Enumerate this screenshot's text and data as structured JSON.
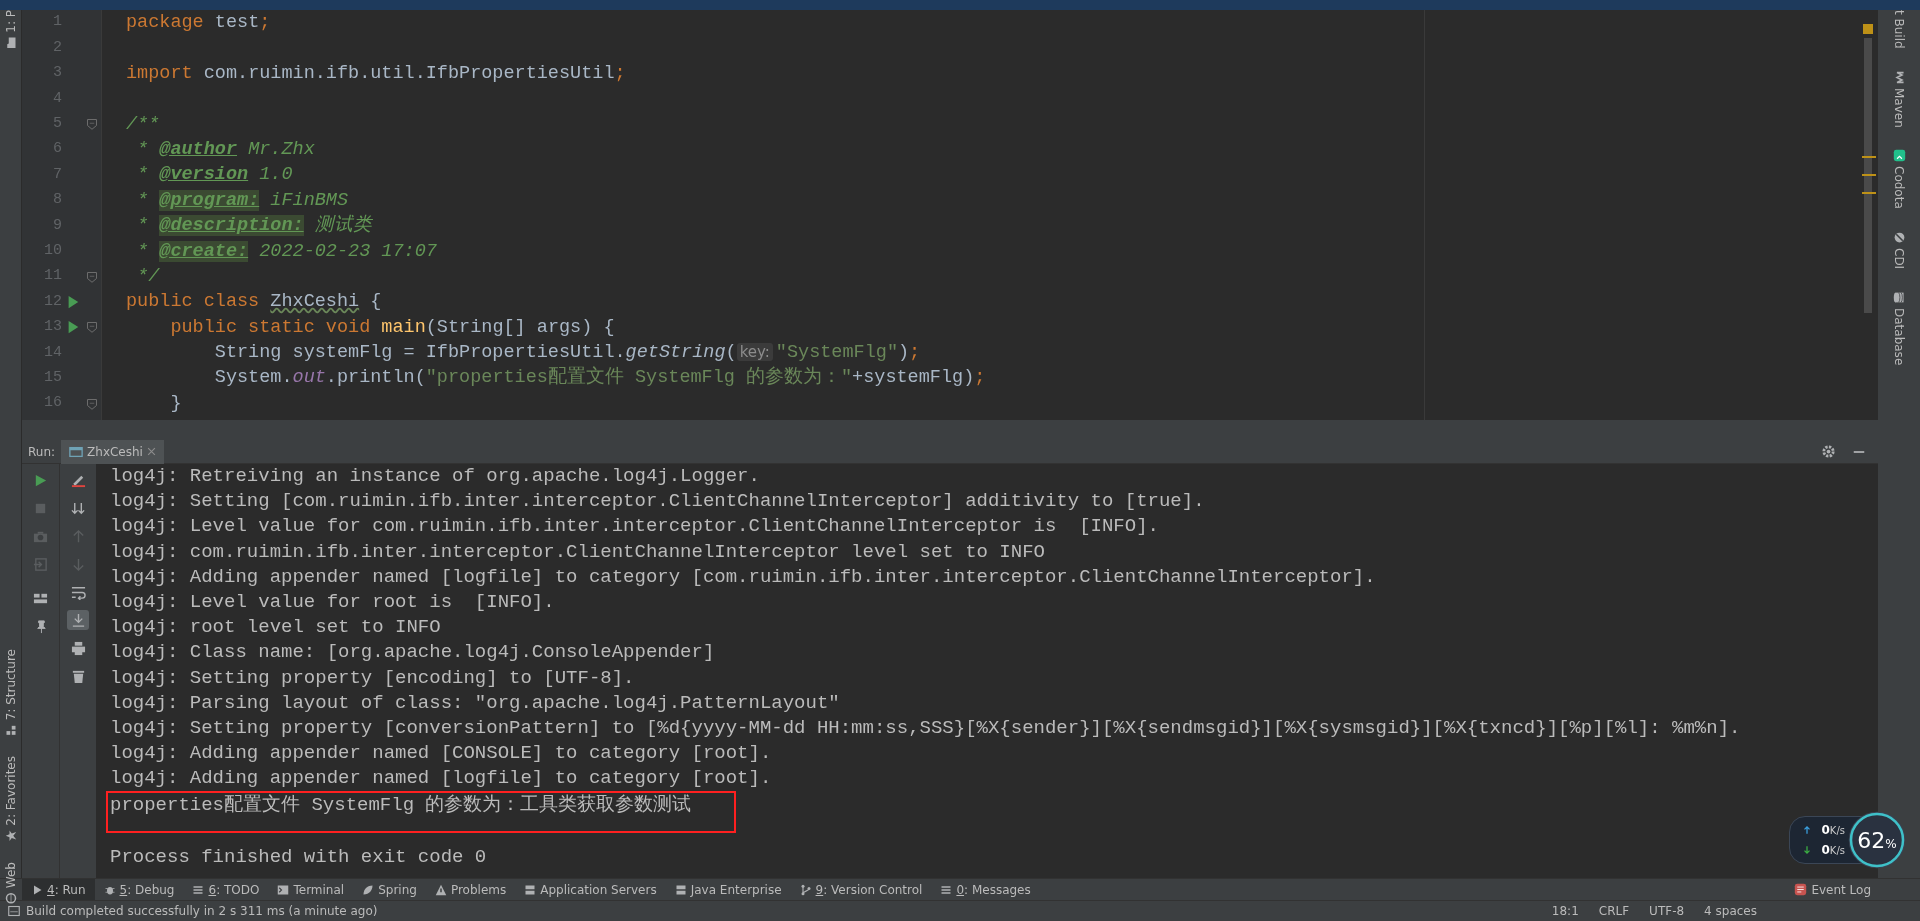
{
  "left_stripe": {
    "items": [
      {
        "label": "1: P"
      },
      {
        "label": "7: Structure"
      },
      {
        "label": "2: Favorites"
      },
      {
        "label": "Web"
      }
    ]
  },
  "right_stripe": {
    "items": [
      {
        "label": "t Build"
      },
      {
        "label": "Maven"
      },
      {
        "label": "Codota"
      },
      {
        "label": "CDI"
      },
      {
        "label": "Database"
      }
    ]
  },
  "editor": {
    "lines": [
      {
        "number": "1",
        "run": false,
        "fold": false,
        "tokens": [
          {
            "kind": "keyword",
            "text": "package "
          },
          {
            "kind": "plain",
            "text": "test"
          },
          {
            "kind": "keyword",
            "text": ";"
          }
        ]
      },
      {
        "number": "2",
        "run": false,
        "fold": false
      },
      {
        "number": "3",
        "run": false,
        "fold": false,
        "tokens": [
          {
            "kind": "keyword",
            "text": "import "
          },
          {
            "kind": "plain",
            "text": "com.ruimin.ifb.util.IfbPropertiesUtil"
          },
          {
            "kind": "keyword",
            "text": ";"
          }
        ]
      },
      {
        "number": "4",
        "run": false,
        "fold": false
      },
      {
        "number": "5",
        "run": false,
        "fold": true,
        "tokens": [
          {
            "kind": "doc",
            "text": "/**"
          }
        ]
      },
      {
        "number": "6",
        "run": false,
        "fold": false,
        "tokens": [
          {
            "kind": "doc",
            "text": " * "
          },
          {
            "kind": "doctag",
            "text": "@author"
          },
          {
            "kind": "doc",
            "text": " Mr.Zhx"
          }
        ]
      },
      {
        "number": "7",
        "run": false,
        "fold": false,
        "tokens": [
          {
            "kind": "doc",
            "text": " * "
          },
          {
            "kind": "doctag",
            "text": "@version"
          },
          {
            "kind": "doc",
            "text": " 1.0"
          }
        ]
      },
      {
        "number": "8",
        "run": false,
        "fold": false,
        "tokens": [
          {
            "kind": "doc",
            "text": " * "
          },
          {
            "kind": "doctag-unknown",
            "text": "@program:"
          },
          {
            "kind": "doc",
            "text": " iFinBMS"
          }
        ]
      },
      {
        "number": "9",
        "run": false,
        "fold": false,
        "tokens": [
          {
            "kind": "doc",
            "text": " * "
          },
          {
            "kind": "doctag-unknown",
            "text": "@description:"
          },
          {
            "kind": "doc",
            "text": " 测试类"
          }
        ]
      },
      {
        "number": "10",
        "run": false,
        "fold": false,
        "tokens": [
          {
            "kind": "doc",
            "text": " * "
          },
          {
            "kind": "doctag-unknown",
            "text": "@create:"
          },
          {
            "kind": "doc",
            "text": " 2022-02-23 17:07"
          }
        ]
      },
      {
        "number": "11",
        "run": false,
        "fold": true,
        "tokens": [
          {
            "kind": "doc",
            "text": " */"
          }
        ]
      },
      {
        "number": "12",
        "run": true,
        "fold": false,
        "tokens": [
          {
            "kind": "keyword",
            "text": "public class "
          },
          {
            "kind": "warn",
            "text": "ZhxCeshi"
          },
          {
            "kind": "plain",
            "text": " {"
          }
        ]
      },
      {
        "number": "13",
        "run": true,
        "fold": true,
        "tokens": [
          {
            "kind": "keyword",
            "text": "    public static void "
          },
          {
            "kind": "method",
            "text": "main"
          },
          {
            "kind": "plain",
            "text": "(String[] args) {"
          }
        ]
      },
      {
        "number": "14",
        "run": false,
        "fold": false,
        "tokens": [
          {
            "kind": "plain",
            "text": "        String systemFlg = IfbPropertiesUtil."
          },
          {
            "kind": "static-method",
            "text": "getString"
          },
          {
            "kind": "plain",
            "text": "("
          },
          {
            "kind": "hint",
            "text": "key:"
          },
          {
            "kind": "string",
            "text": "\"SystemFlg\""
          },
          {
            "kind": "plain",
            "text": ")"
          },
          {
            "kind": "keyword",
            "text": ";"
          }
        ]
      },
      {
        "number": "15",
        "run": false,
        "fold": false,
        "tokens": [
          {
            "kind": "plain",
            "text": "        System."
          },
          {
            "kind": "static-field",
            "text": "out"
          },
          {
            "kind": "plain",
            "text": ".println("
          },
          {
            "kind": "string",
            "text": "\"properties配置文件 SystemFlg 的参数为：\""
          },
          {
            "kind": "plain",
            "text": "+systemFlg)"
          },
          {
            "kind": "keyword",
            "text": ";"
          }
        ]
      },
      {
        "number": "16",
        "run": false,
        "fold": true,
        "tokens": [
          {
            "kind": "plain",
            "text": "    }"
          }
        ]
      }
    ]
  },
  "run_panel": {
    "label": "Run:",
    "tabs": [
      {
        "label": "ZhxCeshi",
        "selected": true
      }
    ],
    "console": [
      {
        "text": "log4j: Retreiving an instance of org.apache.log4j.Logger.",
        "highlighted": false
      },
      {
        "text": "log4j: Setting [com.ruimin.ifb.inter.interceptor.ClientChannelInterceptor] additivity to [true].",
        "highlighted": false
      },
      {
        "text": "log4j: Level value for com.ruimin.ifb.inter.interceptor.ClientChannelInterceptor is  [INFO].",
        "highlighted": false
      },
      {
        "text": "log4j: com.ruimin.ifb.inter.interceptor.ClientChannelInterceptor level set to INFO",
        "highlighted": false
      },
      {
        "text": "log4j: Adding appender named [logfile] to category [com.ruimin.ifb.inter.interceptor.ClientChannelInterceptor].",
        "highlighted": false
      },
      {
        "text": "log4j: Level value for root is  [INFO].",
        "highlighted": false
      },
      {
        "text": "log4j: root level set to INFO",
        "highlighted": false
      },
      {
        "text": "log4j: Class name: [org.apache.log4j.ConsoleAppender]",
        "highlighted": false
      },
      {
        "text": "log4j: Setting property [encoding] to [UTF-8].",
        "highlighted": false
      },
      {
        "text": "log4j: Parsing layout of class: \"org.apache.log4j.PatternLayout\"",
        "highlighted": false
      },
      {
        "text": "log4j: Setting property [conversionPattern] to [%d{yyyy-MM-dd HH:mm:ss,SSS}[%X{sender}][%X{sendmsgid}][%X{sysmsgid}][%X{txncd}][%p][%l]: %m%n].",
        "highlighted": false
      },
      {
        "text": "log4j: Adding appender named [CONSOLE] to category [root].",
        "highlighted": false
      },
      {
        "text": "log4j: Adding appender named [logfile] to category [root].",
        "highlighted": false
      },
      {
        "text": "properties配置文件 SystemFlg 的参数为：工具类获取参数测试",
        "highlighted": true
      },
      {
        "text": "Process finished with exit code 0",
        "highlighted": false
      }
    ]
  },
  "tool_tabs": [
    {
      "mnemonic": "4",
      "label": ": Run",
      "selected": true
    },
    {
      "mnemonic": "5",
      "label": ": Debug",
      "selected": false
    },
    {
      "mnemonic": "6",
      "label": ": TODO",
      "selected": false
    },
    {
      "label": "Terminal",
      "selected": false
    },
    {
      "label": "Spring",
      "selected": false
    },
    {
      "label": "Problems",
      "selected": false
    },
    {
      "label": "Application Servers",
      "selected": false
    },
    {
      "label": "Java Enterprise",
      "selected": false
    },
    {
      "mnemonic": "9",
      "label": ": Version Control",
      "selected": false
    },
    {
      "mnemonic": "0",
      "label": ": Messages",
      "selected": false
    }
  ],
  "event_log": {
    "label": "Event Log"
  },
  "status_bar": {
    "message": "Build completed successfully in 2 s 311 ms (a minute ago)",
    "items": [
      "18:1",
      "CRLF",
      "UTF-8",
      "4 spaces"
    ]
  },
  "net_widget": {
    "upload": "0",
    "upload_unit": "K/s",
    "download": "0",
    "download_unit": "K/s",
    "percent": "62",
    "percent_sign": "%"
  }
}
